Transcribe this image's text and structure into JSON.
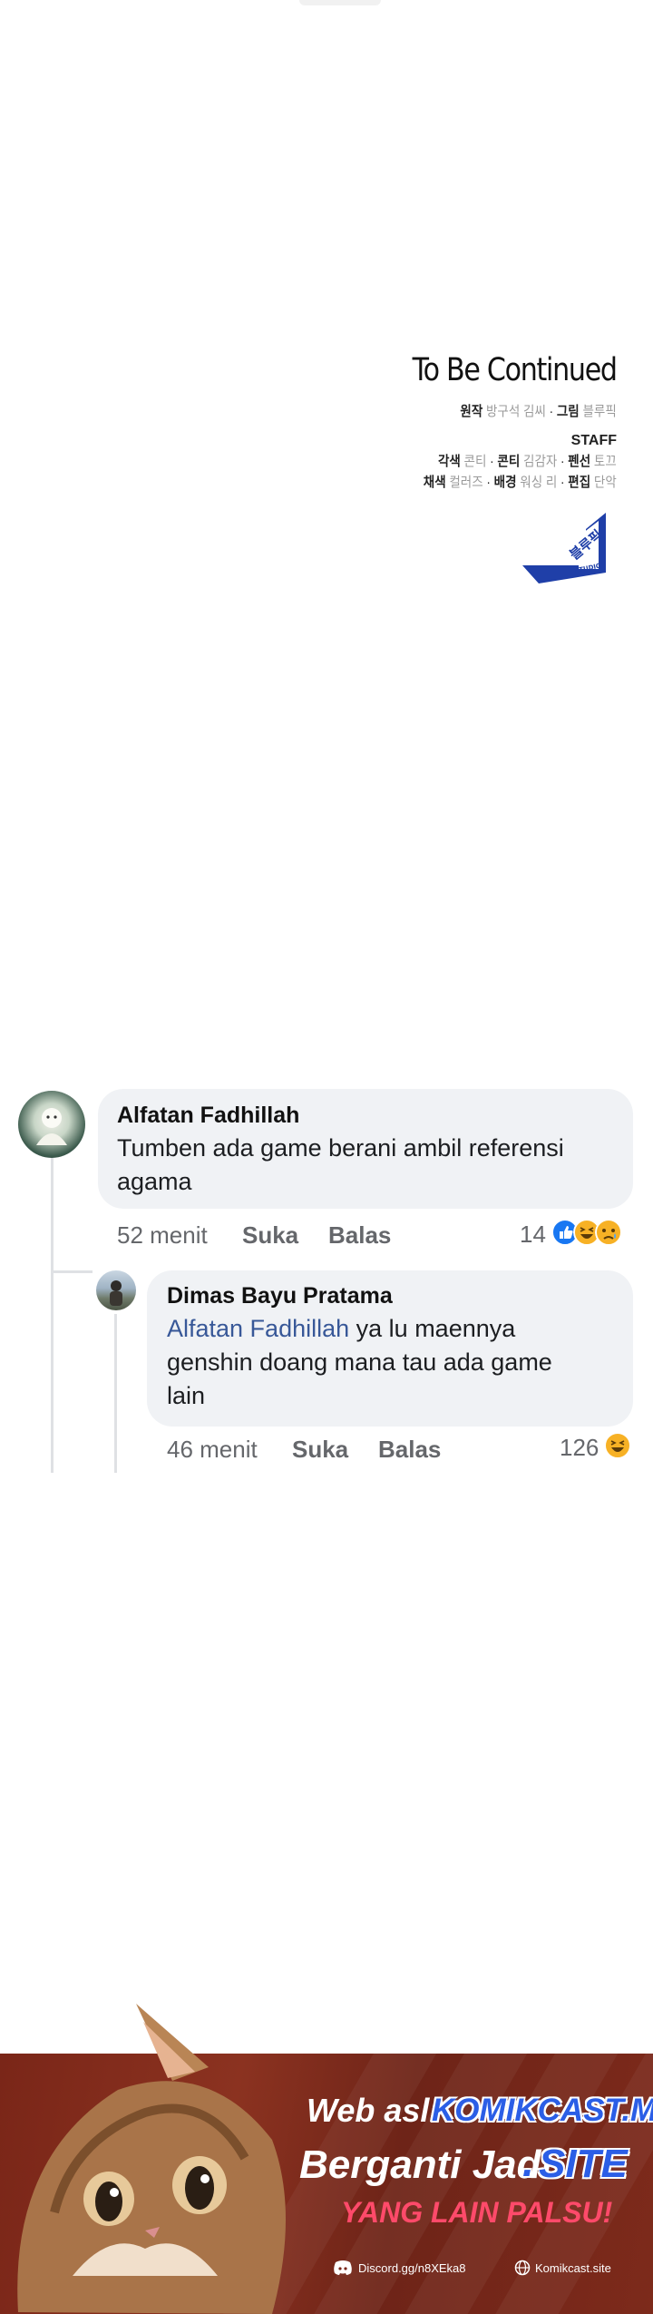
{
  "credits": {
    "title": "To Be Continued",
    "line1_a": "원작",
    "line1_b": "방구석 김씨",
    "line1_c": "그림",
    "line1_d": "블루픽",
    "staff": "STAFF",
    "line2": "각색 콘티 · 콘티 김감자 · 펜선 토끄",
    "line2_a": "각색",
    "line2_b": "콘티",
    "line2_c": "콘티",
    "line2_d": "김감자",
    "line2_e": "펜선",
    "line2_f": "토끄",
    "line3_a": "채색",
    "line3_b": "컬러즈",
    "line3_c": "배경",
    "line3_d": "워싱 리",
    "line3_e": "편집",
    "line3_f": "단악",
    "logo_text": "블루픽",
    "logo_sub": "STUDIO"
  },
  "comments": [
    {
      "author": "Alfatan Fadhillah",
      "text_line1": "Tumben ada game berani ambil referensi",
      "text_line2": "agama",
      "time": "52 menit",
      "like": "Suka",
      "reply": "Balas",
      "reaction_count": "14",
      "reactions": [
        "like-icon",
        "haha-icon",
        "sad-icon"
      ]
    },
    {
      "author": "Dimas Bayu Pratama",
      "mention": "Alfatan Fadhillah",
      "text_line1_rest": "ya lu maennya",
      "text_line2": "genshin doang mana tau ada game",
      "text_line3": "lain",
      "time": "46 menit",
      "like": "Suka",
      "reply": "Balas",
      "reaction_count": "126",
      "reactions": [
        "haha-icon"
      ]
    }
  ],
  "banner": {
    "web_asli": "Web asli",
    "site_old": "KOMIKCAST.ME",
    "berganti": "Berganti Jadi",
    "dot": ".",
    "site_new": "SITE",
    "warning": "YANG LAIN PALSU!",
    "discord": "Discord.gg/n8XEka8",
    "website": "Komikcast.site"
  },
  "colors": {
    "bubble": "#f0f2f5",
    "mention": "#385898",
    "banner": "#7a2618",
    "site_blue": "#2b5ee6",
    "warning_pink": "#ff4a6a"
  }
}
